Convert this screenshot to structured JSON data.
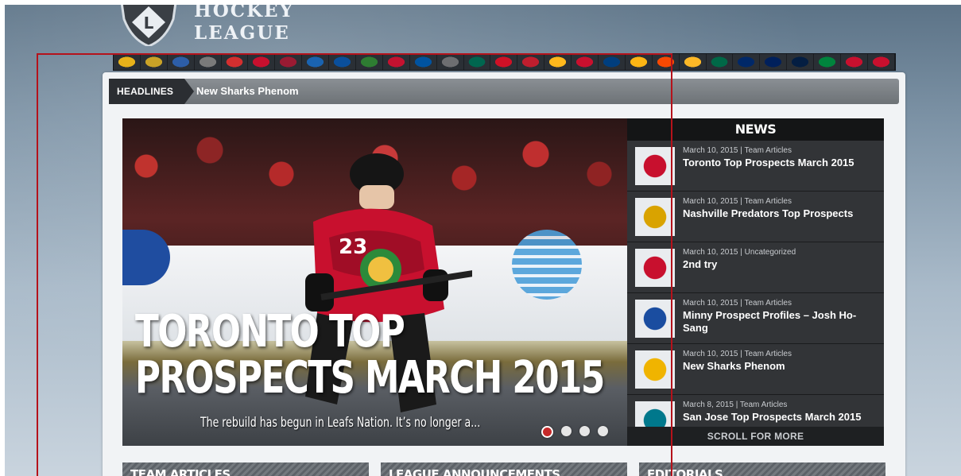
{
  "logo": {
    "line1": "HOCKEY",
    "line2": "LEAGUE",
    "shield_letter": "L"
  },
  "headline": {
    "label": "HEADLINES",
    "text": "New Sharks Phenom"
  },
  "slider": {
    "title_line1": "TORONTO TOP",
    "title_line2": "PROSPECTS MARCH 2015",
    "excerpt": "The rebuild has begun in Leafs Nation. It’s no longer a...",
    "jersey_number": "23",
    "dots_active_index": 0
  },
  "news": {
    "header": "NEWS",
    "items": [
      {
        "date": "March 10, 2015",
        "category": "Team Articles",
        "title": "Toronto Top Prospects March 2015"
      },
      {
        "date": "March 10, 2015",
        "category": "Team Articles",
        "title": "Nashville Predators Top Prospects"
      },
      {
        "date": "March 10, 2015",
        "category": "Uncategorized",
        "title": "2nd try"
      },
      {
        "date": "March 10, 2015",
        "category": "Team Articles",
        "title": "Minny Prospect Profiles – Josh Ho-Sang"
      },
      {
        "date": "March 10, 2015",
        "category": "Team Articles",
        "title": "New Sharks Phenom"
      },
      {
        "date": "March 8, 2015",
        "category": "Team Articles",
        "title": "San Jose Top Prospects March 2015"
      }
    ],
    "scroll_more": "SCROLL FOR MORE",
    "meta_separator": " | "
  },
  "sections": [
    {
      "label": "TEAM ARTICLES"
    },
    {
      "label": "LEAGUE ANNOUNCEMENTS"
    },
    {
      "label": "EDITORIALS"
    }
  ],
  "colors": {
    "accent_red": "#c62a2a",
    "overlay_line_red": "#b5121b",
    "news_bg": "#2e3033",
    "headline_bar": "#6d7276"
  },
  "team_strip": {
    "logo_colors": [
      "#e8b21a",
      "#c9a227",
      "#2d5ea8",
      "#7a7a7a",
      "#d32f2f",
      "#c8102e",
      "#9a1b33",
      "#1a63b0",
      "#0a4f9c",
      "#2e7d32",
      "#c41230",
      "#0053a0",
      "#6d6e71",
      "#00664f",
      "#ce1126",
      "#bf1e2e",
      "#ffb81c",
      "#c8102e",
      "#003e7e",
      "#fcb514",
      "#f74902",
      "#fdb827",
      "#006847",
      "#002868",
      "#00205b",
      "#041e42",
      "#00843d",
      "#c8102e",
      "#c8102e"
    ]
  }
}
